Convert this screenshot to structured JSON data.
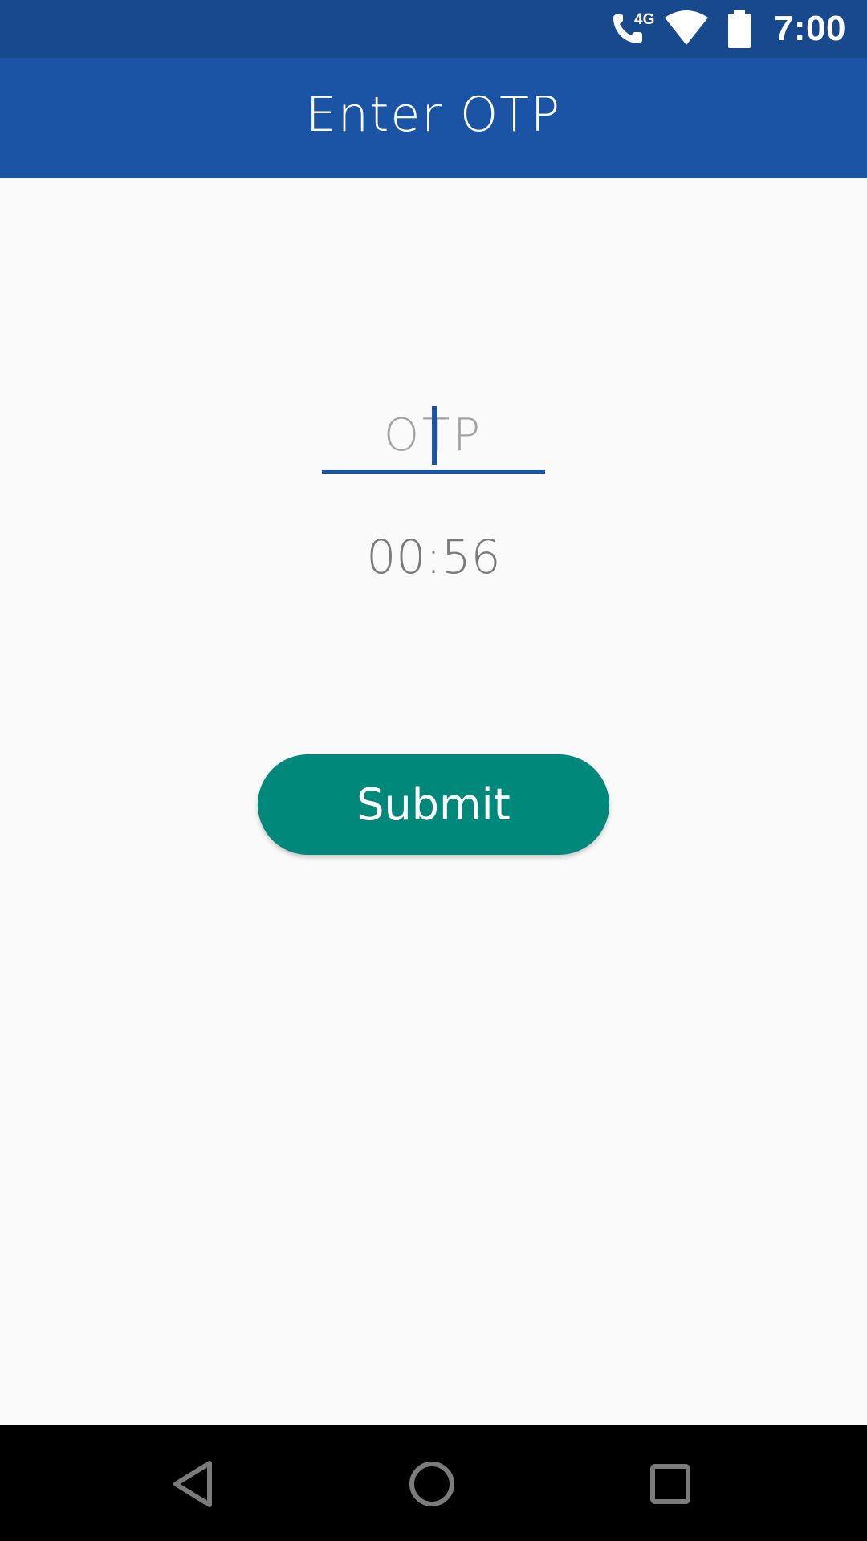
{
  "status_bar": {
    "time": "7:00",
    "network_label": "4G",
    "icons": [
      "call-4g-icon",
      "wifi-icon",
      "battery-icon"
    ],
    "color": "#19498d"
  },
  "app_bar": {
    "title": "Enter OTP",
    "color": "#1c54a5"
  },
  "otp": {
    "placeholder": "OTP",
    "value": ""
  },
  "timer": {
    "text": "00:56"
  },
  "submit": {
    "label": "Submit",
    "color": "#00897b"
  },
  "nav_bar": {
    "items": [
      "back-icon",
      "home-icon",
      "recent-apps-icon"
    ]
  }
}
